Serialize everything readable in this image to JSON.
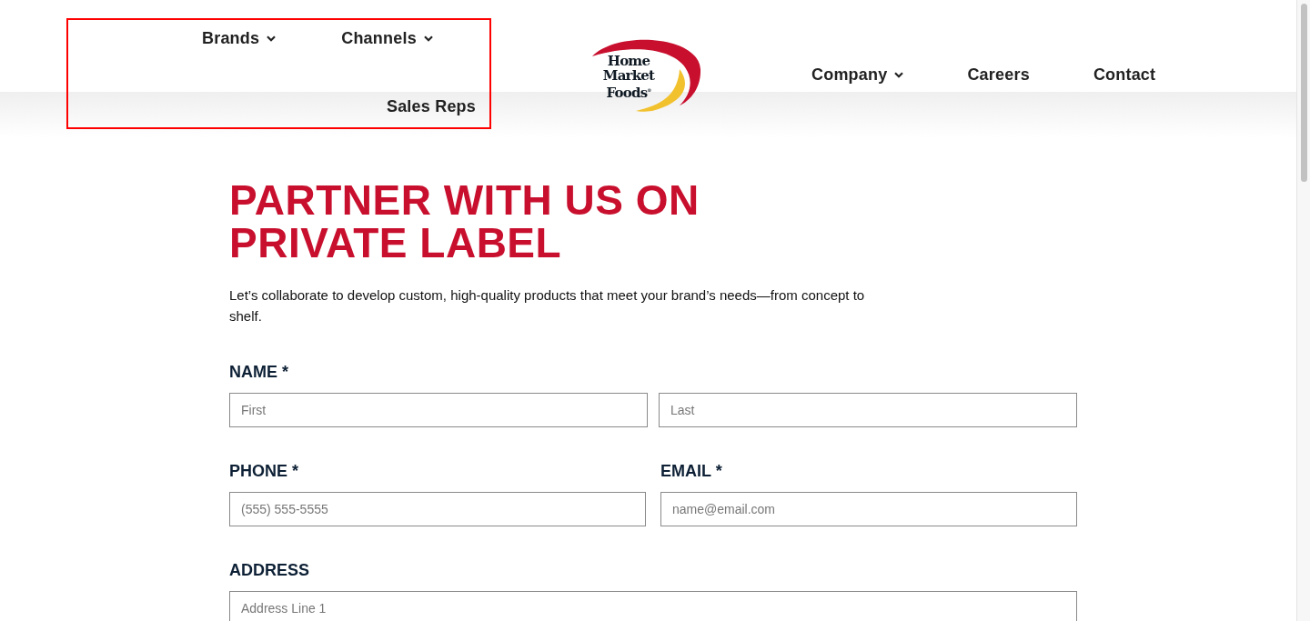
{
  "header": {
    "left_nav": [
      {
        "label": "Brands",
        "has_dropdown": true
      },
      {
        "label": "Channels",
        "has_dropdown": true
      }
    ],
    "left_nav_second_row": [
      {
        "label": "Sales Reps",
        "has_dropdown": false
      }
    ],
    "logo": {
      "lines": [
        "Home",
        "Market",
        "Foods$^{®}$"
      ]
    },
    "right_nav": [
      {
        "label": "Company",
        "has_dropdown": true
      },
      {
        "label": "Careers",
        "has_dropdown": false
      },
      {
        "label": "Contact",
        "has_dropdown": false
      }
    ]
  },
  "main": {
    "title_lines": [
      "PARTNER WITH US ON",
      "PRIVATE LABEL"
    ],
    "intro": "Let’s collaborate to develop custom, high-quality products that meet your brand’s needs—from concept to shelf.",
    "form_rows": [
      {
        "fields": [
          {
            "label": "NAME *",
            "inputs": [
              {
                "placeholder": "First"
              },
              {
                "placeholder": "Last"
              }
            ]
          }
        ]
      },
      {
        "fields": [
          {
            "label": "PHONE *",
            "inputs": [
              {
                "placeholder": "(555) 555-5555"
              }
            ]
          },
          {
            "label": "EMAIL *",
            "inputs": [
              {
                "placeholder": "name@email.com"
              }
            ]
          }
        ]
      },
      {
        "fields": [
          {
            "label": "ADDRESS",
            "inputs": [
              {
                "placeholder": "Address Line 1"
              }
            ]
          }
        ]
      }
    ]
  }
}
